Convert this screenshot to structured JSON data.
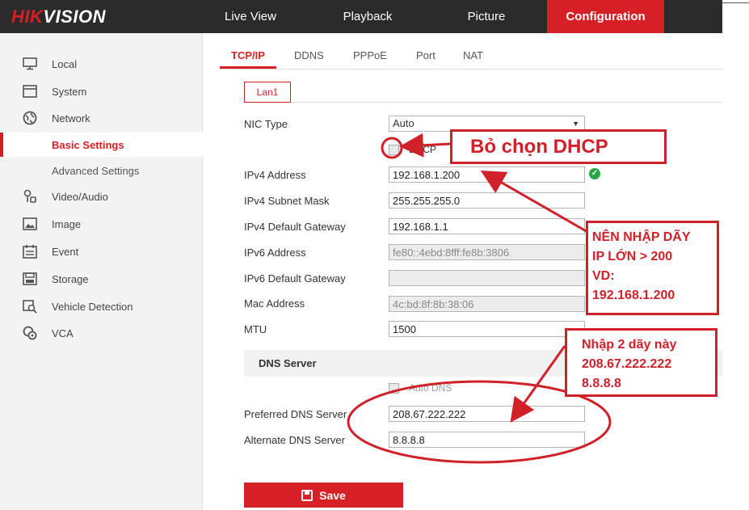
{
  "brand": {
    "red": "HIK",
    "white": "VISION"
  },
  "topnav": [
    {
      "label": "Live View",
      "active": false
    },
    {
      "label": "Playback",
      "active": false
    },
    {
      "label": "Picture",
      "active": false
    },
    {
      "label": "Configuration",
      "active": true
    }
  ],
  "sidebar": [
    {
      "label": "Local",
      "icon": "monitor-icon"
    },
    {
      "label": "System",
      "icon": "window-icon"
    },
    {
      "label": "Network",
      "icon": "globe-icon"
    },
    {
      "label": "Basic Settings",
      "icon": "",
      "selected": true
    },
    {
      "label": "Advanced Settings",
      "icon": ""
    },
    {
      "label": "Video/Audio",
      "icon": "camera-mic-icon"
    },
    {
      "label": "Image",
      "icon": "image-icon"
    },
    {
      "label": "Event",
      "icon": "calendar-icon"
    },
    {
      "label": "Storage",
      "icon": "storage-icon"
    },
    {
      "label": "Vehicle Detection",
      "icon": "vehicle-icon"
    },
    {
      "label": "VCA",
      "icon": "vca-icon"
    }
  ],
  "tabs": [
    "TCP/IP",
    "DDNS",
    "PPPoE",
    "Port",
    "NAT"
  ],
  "subtab": "Lan1",
  "form": {
    "nic_type_label": "NIC Type",
    "nic_type_value": "Auto",
    "dhcp_label": "DHCP",
    "ipv4_address_label": "IPv4 Address",
    "ipv4_address": "192.168.1.200",
    "ipv4_mask_label": "IPv4 Subnet Mask",
    "ipv4_mask": "255.255.255.0",
    "ipv4_gateway_label": "IPv4 Default Gateway",
    "ipv4_gateway": "192.168.1.1",
    "ipv6_address_label": "IPv6 Address",
    "ipv6_address": "fe80::4ebd:8fff:fe8b:3806",
    "ipv6_gateway_label": "IPv6 Default Gateway",
    "ipv6_gateway": "",
    "mac_label": "Mac Address",
    "mac": "4c:bd:8f:8b:38:06",
    "mtu_label": "MTU",
    "mtu": "1500",
    "dns_header": "DNS Server",
    "auto_dns_label": "Auto DNS",
    "preferred_dns_label": "Preferred DNS Server",
    "preferred_dns": "208.67.222.222",
    "alternate_dns_label": "Alternate DNS Server",
    "alternate_dns": "8.8.8.8",
    "save_label": "Save"
  },
  "annotations": {
    "dhcp_note": "Bỏ chọn DHCP",
    "ip_note": [
      "NÊN NHẬP DÃY",
      "IP LỚN > 200",
      "VD:",
      "192.168.1.200"
    ],
    "dns_note": [
      "Nhập 2 dãy này",
      "208.67.222.222",
      "8.8.8.8"
    ]
  },
  "colors": {
    "accent": "#d71f26",
    "annotation": "#d0202a",
    "topbar": "#2b2b2b",
    "ok": "#27a844"
  }
}
